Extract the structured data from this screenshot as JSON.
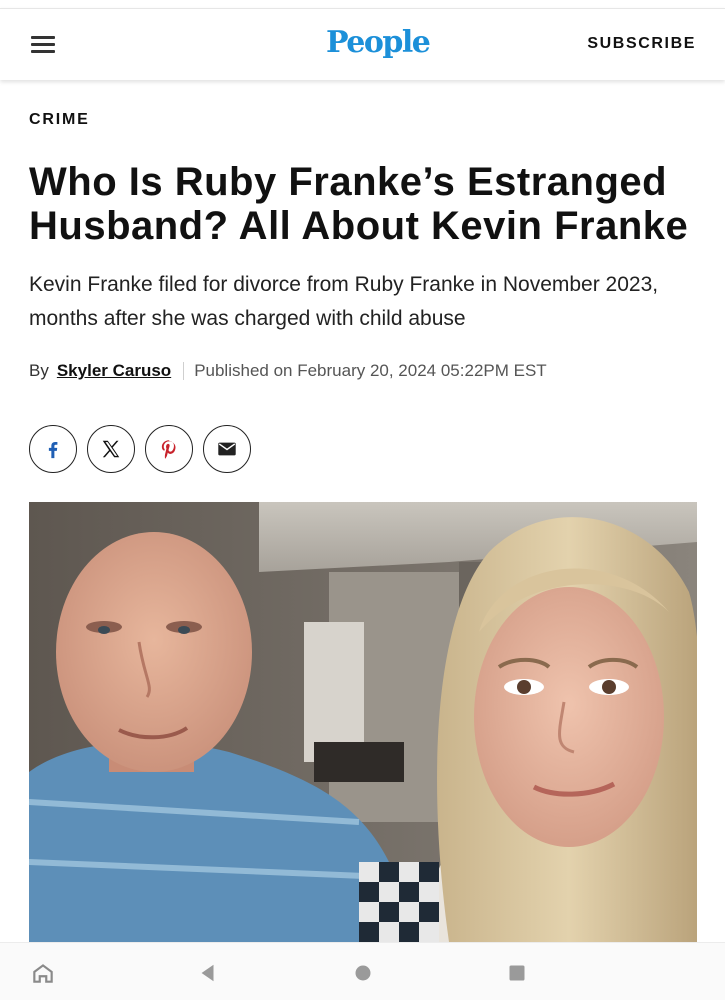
{
  "header": {
    "logo_text": "People",
    "subscribe_label": "SUBSCRIBE",
    "brand_color": "#1c90d9"
  },
  "article": {
    "category": "CRIME",
    "headline": "Who Is Ruby Franke’s Estranged Husband? All About Kevin Franke",
    "dek": "Kevin Franke filed for divorce from Ruby Franke in November 2023, months after she was charged with child abuse",
    "byline_prefix": "By",
    "author": "Skyler Caruso",
    "published": "Published on February 20, 2024 05:22PM EST"
  },
  "share_buttons": [
    {
      "name": "facebook-icon",
      "color": "#1f5fb4"
    },
    {
      "name": "x-icon",
      "color": "#111111"
    },
    {
      "name": "pinterest-icon",
      "color": "#c8232c"
    },
    {
      "name": "email-icon",
      "color": "#222222"
    }
  ],
  "navigation_bar": [
    "home-icon",
    "back-icon",
    "circle-home-icon",
    "recents-icon"
  ]
}
